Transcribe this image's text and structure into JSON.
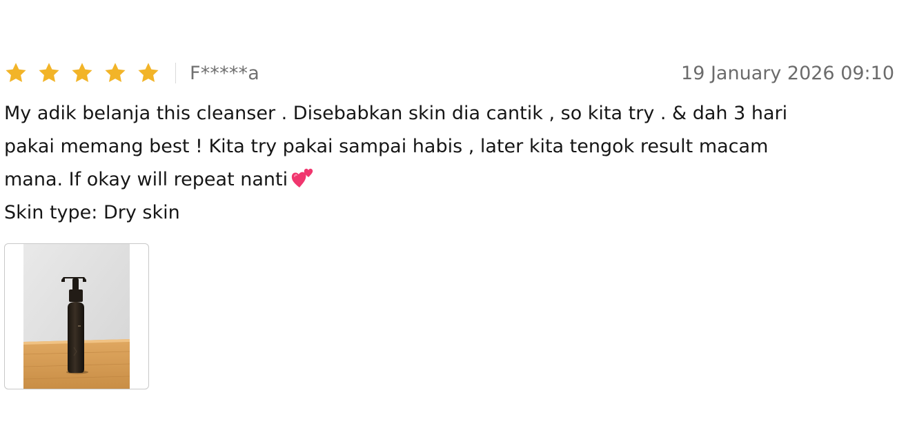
{
  "review": {
    "rating": 5,
    "rating_max": 5,
    "star_color": "#F2B428",
    "username": "F*****a",
    "timestamp": "19 January 2026 09:10",
    "text_lines": [
      "My adik belanja this cleanser . Disebabkan skin dia cantik , so kita try . & dah 3 hari",
      "pakai memang best ! Kita try pakai sampai habis , later kita tengok result macam",
      "mana. If okay will repeat nanti"
    ],
    "emoji": "two-hearts",
    "skin_type": "Skin type: Dry skin",
    "photo": "cleanser-bottle-photo"
  }
}
